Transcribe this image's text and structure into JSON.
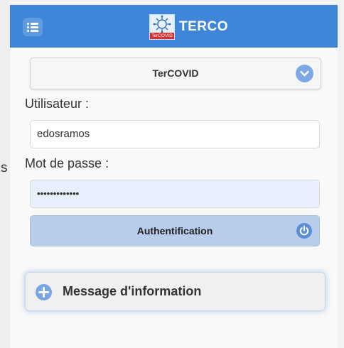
{
  "header": {
    "title": "TERCO",
    "logo_caption": "TerCOVID",
    "color": "#3f85d8"
  },
  "left_peek_text": "s",
  "form": {
    "server_select": {
      "value": "TerCOVID"
    },
    "username": {
      "label": "Utilisateur :",
      "value": "edosramos"
    },
    "password": {
      "label": "Mot de passe :",
      "masked_value": "•••••••••••••"
    },
    "auth_button": {
      "label": "Authentification",
      "icon": "power-icon"
    }
  },
  "info_collapsible": {
    "label": "Message d'information",
    "icon": "plus-circle-icon"
  }
}
